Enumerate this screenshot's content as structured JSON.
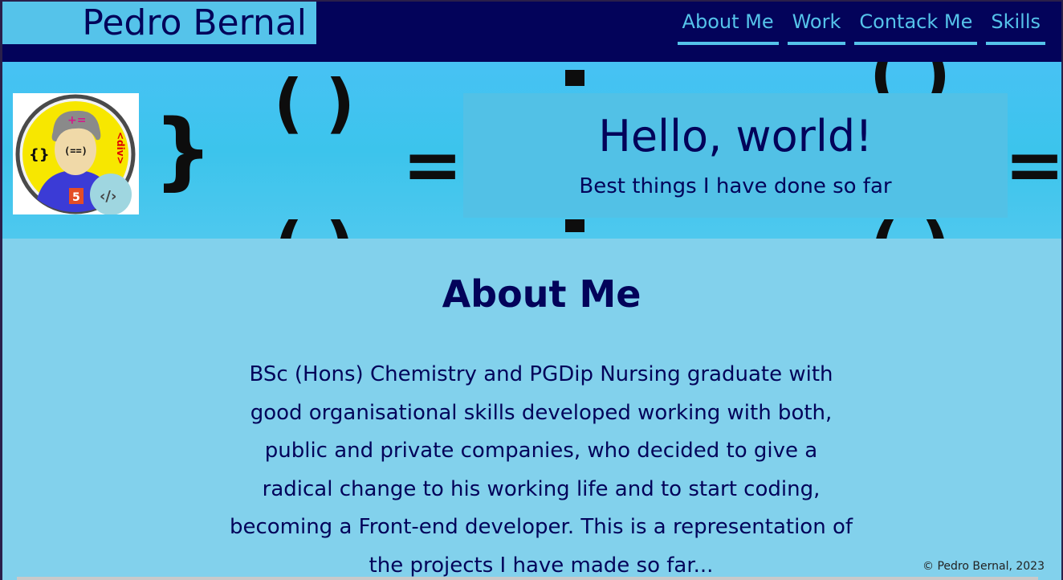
{
  "header": {
    "brand": "Pedro Bernal",
    "nav": [
      {
        "label": "About Me"
      },
      {
        "label": "Work"
      },
      {
        "label": "Contack Me"
      },
      {
        "label": "Skills"
      }
    ]
  },
  "hero": {
    "title": "Hello, world!",
    "subtitle": "Best things I have done so far",
    "avatar": {
      "icon": "developer-avatar-icon",
      "glyphs": {
        "top": "+=",
        "left": "{}",
        "face": "(==)",
        "side": "<div>",
        "badge": "‹/›"
      }
    },
    "background_glyphs": {
      "brace": "}",
      "parens": "( )",
      "equals": "="
    }
  },
  "about": {
    "heading": "About Me",
    "text": "BSc (Hons) Chemistry and PGDip Nursing graduate with good organisational skills developed working with both, public and private companies, who decided to give a radical change to his working life and to start coding, becoming a Front-end developer. This is a representation of the projects I have made so far..."
  },
  "footer": {
    "copyright": "© Pedro Bernal, 2023"
  },
  "colors": {
    "navy": "#03035a",
    "accent": "#55c3ea",
    "hero": "#47c2f4",
    "content": "#82d1ec"
  }
}
